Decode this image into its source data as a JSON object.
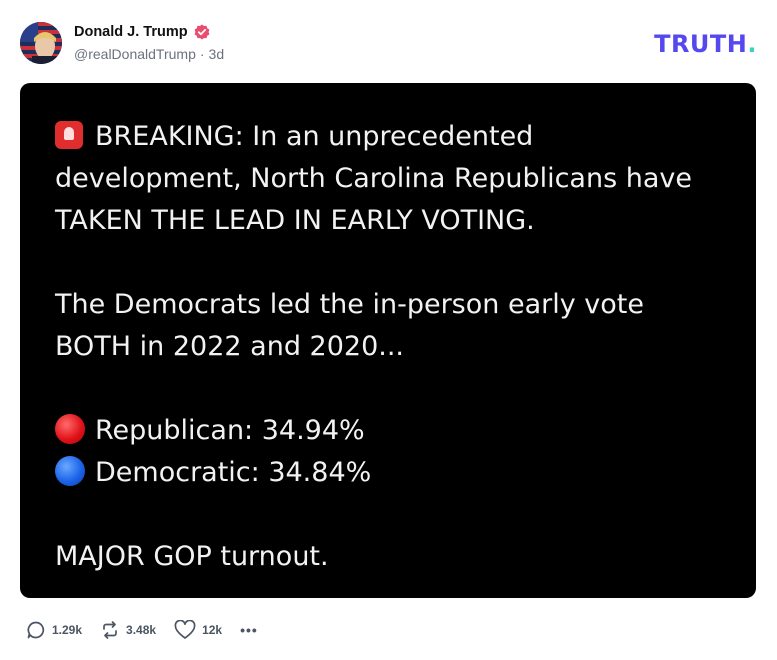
{
  "post": {
    "author_name": "Donald J. Trump",
    "handle": "@realDonaldTrump",
    "separator": "·",
    "age": "3d",
    "brand_word": "TRUTH",
    "brand_dot": "."
  },
  "media": {
    "line1": "BREAKING: In an unprecedented",
    "line2": "development, North Carolina Republicans have",
    "line3": "TAKEN THE LEAD IN EARLY VOTING.",
    "line4": "The Democrats led the in-person early vote",
    "line5": "BOTH in 2022 and 2020...",
    "republican": "Republican: 34.94%",
    "democratic": "Democratic: 34.84%",
    "closing": "MAJOR GOP turnout."
  },
  "actions": {
    "replies": "1.29k",
    "retruths": "3.48k",
    "likes": "12k",
    "more": "•••"
  },
  "icons": {
    "verified": "verified-badge-icon",
    "siren": "siren-icon",
    "red_dot": "red-circle-icon",
    "blue_dot": "blue-circle-icon",
    "reply": "reply-icon",
    "retruth": "retruth-icon",
    "like": "heart-icon",
    "more": "more-icon"
  },
  "colors": {
    "brand": "#5448ee",
    "brand_accent": "#3bd3c0",
    "verified": "#ea4c6d",
    "media_bg": "#000000"
  }
}
